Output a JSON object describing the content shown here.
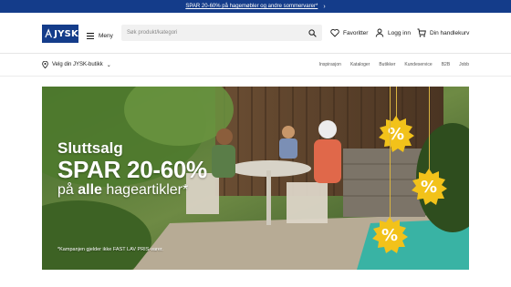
{
  "promo": {
    "text": "SPAR 20-60% på hagemøbler og andre sommervarer*",
    "chevron_icon": "chevron-right-icon"
  },
  "header": {
    "logo_text": "JYSK",
    "menu_label": "Meny",
    "search_placeholder": "Søk produkt/kategori",
    "favorites_label": "Favoritter",
    "login_label": "Logg inn",
    "cart_label": "Din handlekurv"
  },
  "subnav": {
    "store_label": "Velg din JYSK-butikk",
    "links": [
      "Inspirasjon",
      "Kataloger",
      "Butikker",
      "Kundeservice",
      "B2B",
      "Jobb"
    ]
  },
  "hero": {
    "line1": "Sluttsalg",
    "line2": "SPAR 20-60%",
    "line3_prefix": "på ",
    "line3_bold": "alle",
    "line3_suffix": " hageartikler*",
    "disclaimer": "*Kampanjen gjelder ikke FAST LAV PRIS-varer.",
    "badge_symbol": "%"
  },
  "colors": {
    "brand": "#143c8a",
    "badge": "#f2c21a"
  }
}
